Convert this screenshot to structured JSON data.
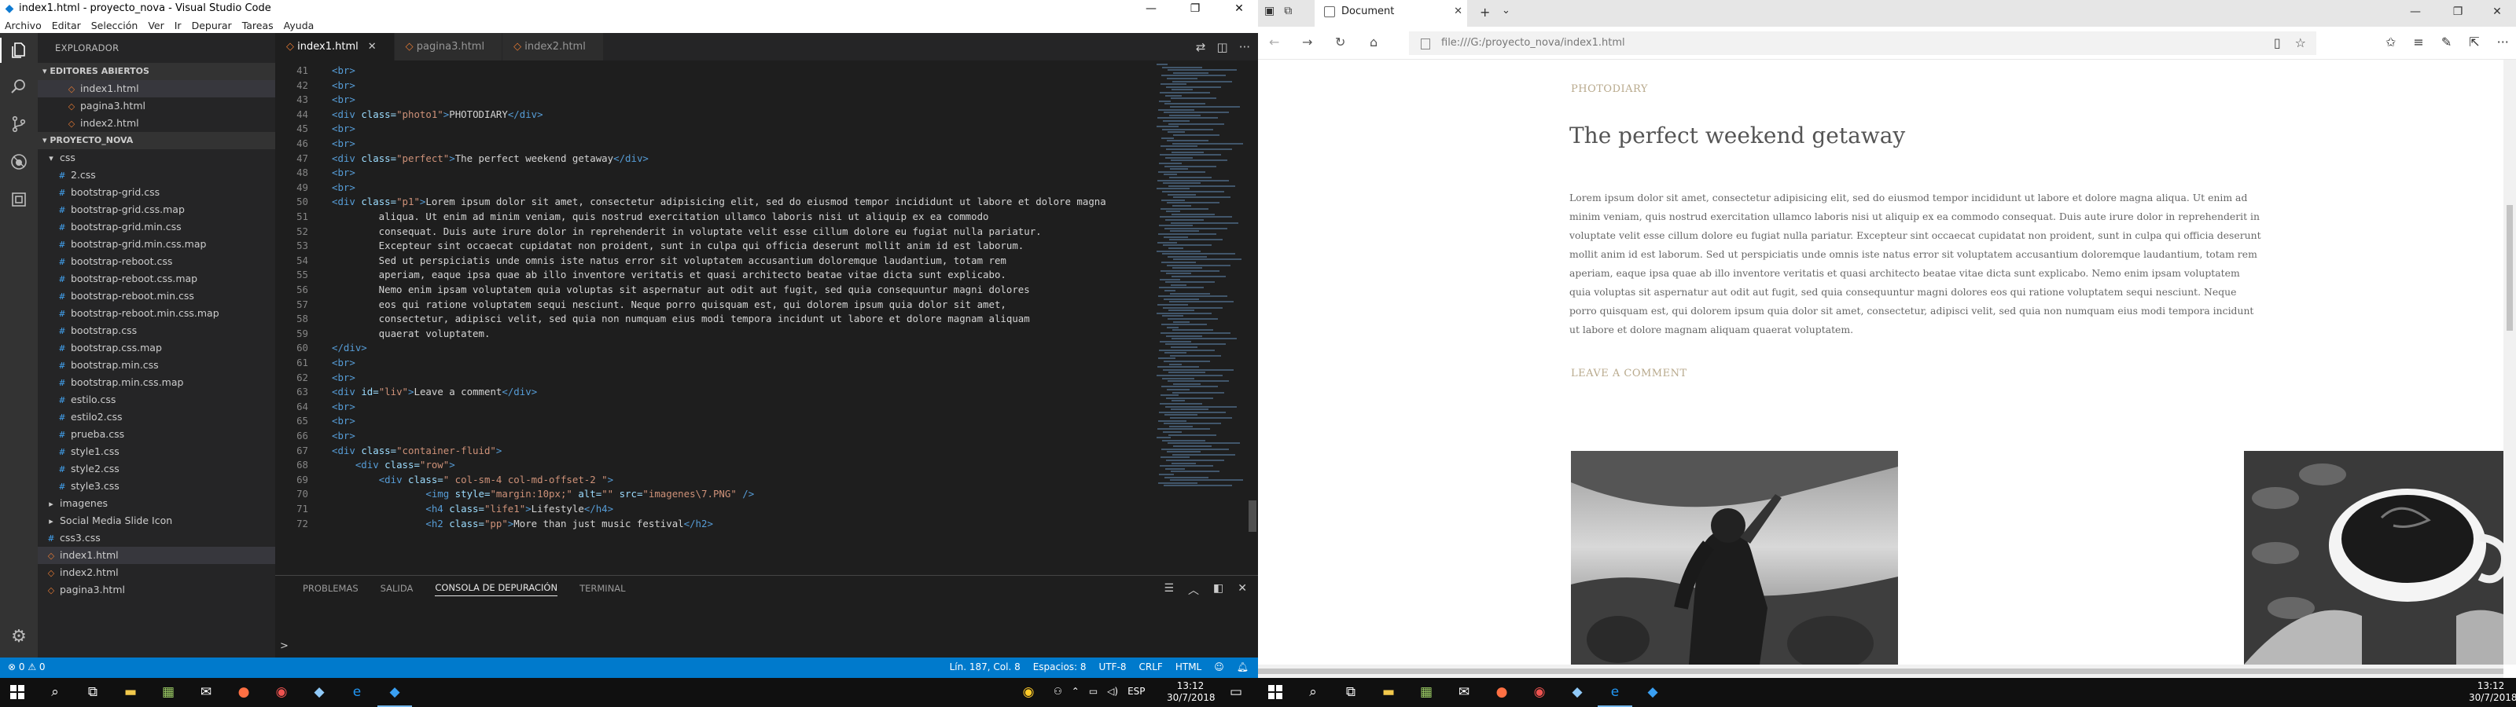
{
  "vscode": {
    "title": "index1.html - proyecto_nova - Visual Studio Code",
    "menu": [
      "Archivo",
      "Editar",
      "Selección",
      "Ver",
      "Ir",
      "Depurar",
      "Tareas",
      "Ayuda"
    ],
    "explorer_title": "EXPLORADOR",
    "open_editors_label": "EDITORES ABIERTOS",
    "open_editors": [
      {
        "name": "index1.html",
        "type": "html",
        "selected": true
      },
      {
        "name": "pagina3.html",
        "type": "html",
        "selected": false
      },
      {
        "name": "index2.html",
        "type": "html",
        "selected": false
      }
    ],
    "project_label": "PROYECTO_NOVA",
    "tree": [
      {
        "name": "css",
        "type": "folder",
        "indent": 1
      },
      {
        "name": "2.css",
        "type": "css",
        "indent": 2
      },
      {
        "name": "bootstrap-grid.css",
        "type": "css",
        "indent": 2
      },
      {
        "name": "bootstrap-grid.css.map",
        "type": "css",
        "indent": 2
      },
      {
        "name": "bootstrap-grid.min.css",
        "type": "css",
        "indent": 2
      },
      {
        "name": "bootstrap-grid.min.css.map",
        "type": "css",
        "indent": 2
      },
      {
        "name": "bootstrap-reboot.css",
        "type": "css",
        "indent": 2
      },
      {
        "name": "bootstrap-reboot.css.map",
        "type": "css",
        "indent": 2
      },
      {
        "name": "bootstrap-reboot.min.css",
        "type": "css",
        "indent": 2
      },
      {
        "name": "bootstrap-reboot.min.css.map",
        "type": "css",
        "indent": 2
      },
      {
        "name": "bootstrap.css",
        "type": "css",
        "indent": 2
      },
      {
        "name": "bootstrap.css.map",
        "type": "css",
        "indent": 2
      },
      {
        "name": "bootstrap.min.css",
        "type": "css",
        "indent": 2
      },
      {
        "name": "bootstrap.min.css.map",
        "type": "css",
        "indent": 2
      },
      {
        "name": "estilo.css",
        "type": "css",
        "indent": 2
      },
      {
        "name": "estilo2.css",
        "type": "css",
        "indent": 2
      },
      {
        "name": "prueba.css",
        "type": "css",
        "indent": 2
      },
      {
        "name": "style1.css",
        "type": "css",
        "indent": 2
      },
      {
        "name": "style2.css",
        "type": "css",
        "indent": 2
      },
      {
        "name": "style3.css",
        "type": "css",
        "indent": 2
      },
      {
        "name": "imagenes",
        "type": "folder-closed",
        "indent": 1
      },
      {
        "name": "Social Media Slide Icon",
        "type": "folder-closed",
        "indent": 1
      },
      {
        "name": "css3.css",
        "type": "css",
        "indent": 1
      },
      {
        "name": "index1.html",
        "type": "html",
        "indent": 1,
        "selected": true
      },
      {
        "name": "index2.html",
        "type": "html",
        "indent": 1
      },
      {
        "name": "pagina3.html",
        "type": "html",
        "indent": 1
      }
    ],
    "tabs": [
      {
        "label": "index1.html",
        "active": true,
        "closable": true
      },
      {
        "label": "pagina3.html",
        "active": false
      },
      {
        "label": "index2.html",
        "active": false
      }
    ],
    "code_lines": [
      {
        "n": "41",
        "parts": [
          [
            "tg",
            "<br>"
          ]
        ]
      },
      {
        "n": "42",
        "parts": [
          [
            "tg",
            "<br>"
          ]
        ]
      },
      {
        "n": "43",
        "parts": [
          [
            "tg",
            "<br>"
          ]
        ]
      },
      {
        "n": "44",
        "parts": [
          [
            "tg",
            "<div "
          ],
          [
            "at",
            "class="
          ],
          [
            "st",
            "\"photo1\""
          ],
          [
            "tg",
            ">"
          ],
          [
            "tx",
            "PHOTODIARY"
          ],
          [
            "tg",
            "</div>"
          ]
        ]
      },
      {
        "n": "45",
        "parts": [
          [
            "tg",
            "<br>"
          ]
        ]
      },
      {
        "n": "46",
        "parts": [
          [
            "tg",
            "<br>"
          ]
        ]
      },
      {
        "n": "47",
        "parts": [
          [
            "tg",
            "<div "
          ],
          [
            "at",
            "class="
          ],
          [
            "st",
            "\"perfect\""
          ],
          [
            "tg",
            ">"
          ],
          [
            "tx",
            "The perfect weekend getaway"
          ],
          [
            "tg",
            "</div>"
          ]
        ]
      },
      {
        "n": "48",
        "parts": [
          [
            "tg",
            "<br>"
          ]
        ]
      },
      {
        "n": "49",
        "parts": [
          [
            "tg",
            "<br>"
          ]
        ]
      },
      {
        "n": "50",
        "parts": [
          [
            "tg",
            "<div "
          ],
          [
            "at",
            "class="
          ],
          [
            "st",
            "\"p1\""
          ],
          [
            "tg",
            ">"
          ],
          [
            "tx",
            "Lorem ipsum dolor sit amet, consectetur adipisicing elit, sed do eiusmod tempor incididunt ut labore et dolore magna"
          ]
        ]
      },
      {
        "n": "51",
        "parts": [
          [
            "tx",
            "        aliqua. Ut enim ad minim veniam, quis nostrud exercitation ullamco laboris nisi ut aliquip ex ea commodo"
          ]
        ]
      },
      {
        "n": "52",
        "parts": [
          [
            "tx",
            "        consequat. Duis aute irure dolor in reprehenderit in voluptate velit esse cillum dolore eu fugiat nulla pariatur."
          ]
        ]
      },
      {
        "n": "53",
        "parts": [
          [
            "tx",
            "        Excepteur sint occaecat cupidatat non proident, sunt in culpa qui officia deserunt mollit anim id est laborum."
          ]
        ]
      },
      {
        "n": "54",
        "parts": [
          [
            "tx",
            "        Sed ut perspiciatis unde omnis iste natus error sit voluptatem accusantium doloremque laudantium, totam rem"
          ]
        ]
      },
      {
        "n": "55",
        "parts": [
          [
            "tx",
            "        aperiam, eaque ipsa quae ab illo inventore veritatis et quasi architecto beatae vitae dicta sunt explicabo."
          ]
        ]
      },
      {
        "n": "56",
        "parts": [
          [
            "tx",
            "        Nemo enim ipsam voluptatem quia voluptas sit aspernatur aut odit aut fugit, sed quia consequuntur magni dolores"
          ]
        ]
      },
      {
        "n": "57",
        "parts": [
          [
            "tx",
            "        eos qui ratione voluptatem sequi nesciunt. Neque porro quisquam est, qui dolorem ipsum quia dolor sit amet,"
          ]
        ]
      },
      {
        "n": "58",
        "parts": [
          [
            "tx",
            "        consectetur, adipisci velit, sed quia non numquam eius modi tempora incidunt ut labore et dolore magnam aliquam"
          ]
        ]
      },
      {
        "n": "59",
        "parts": [
          [
            "tx",
            "        quaerat voluptatem."
          ]
        ]
      },
      {
        "n": "60",
        "parts": [
          [
            "tg",
            "</div>"
          ]
        ]
      },
      {
        "n": "61",
        "parts": [
          [
            "tg",
            "<br>"
          ]
        ]
      },
      {
        "n": "62",
        "parts": [
          [
            "tg",
            "<br>"
          ]
        ]
      },
      {
        "n": "63",
        "parts": [
          [
            "tg",
            "<div "
          ],
          [
            "at",
            "id="
          ],
          [
            "st",
            "\"liv\""
          ],
          [
            "tg",
            ">"
          ],
          [
            "tx",
            "Leave a comment"
          ],
          [
            "tg",
            "</div>"
          ]
        ]
      },
      {
        "n": "64",
        "parts": [
          [
            "tg",
            "<br>"
          ]
        ]
      },
      {
        "n": "65",
        "parts": [
          [
            "tg",
            "<br>"
          ]
        ]
      },
      {
        "n": "66",
        "parts": [
          [
            "tg",
            "<br>"
          ]
        ]
      },
      {
        "n": "67",
        "parts": [
          [
            "tg",
            "<div "
          ],
          [
            "at",
            "class="
          ],
          [
            "st",
            "\"container-fluid\""
          ],
          [
            "tg",
            ">"
          ]
        ]
      },
      {
        "n": "68",
        "parts": [
          [
            "tx",
            "    "
          ],
          [
            "tg",
            "<div "
          ],
          [
            "at",
            "class="
          ],
          [
            "st",
            "\"row\""
          ],
          [
            "tg",
            ">"
          ]
        ]
      },
      {
        "n": "69",
        "parts": [
          [
            "tx",
            "        "
          ],
          [
            "tg",
            "<div "
          ],
          [
            "at",
            "class="
          ],
          [
            "st",
            "\" col-sm-4 col-md-offset-2 \""
          ],
          [
            "tg",
            ">"
          ]
        ]
      },
      {
        "n": "70",
        "parts": [
          [
            "tx",
            "                "
          ],
          [
            "tg",
            "<img "
          ],
          [
            "at",
            "style="
          ],
          [
            "st",
            "\"margin:10px;\""
          ],
          [
            "at",
            " alt="
          ],
          [
            "st",
            "\"\""
          ],
          [
            "at",
            " src="
          ],
          [
            "st",
            "\"imagenes\\7.PNG\""
          ],
          [
            "tg",
            " />"
          ]
        ]
      },
      {
        "n": "71",
        "parts": [
          [
            "tx",
            "                "
          ],
          [
            "tg",
            "<h4 "
          ],
          [
            "at",
            "class="
          ],
          [
            "st",
            "\"life1\""
          ],
          [
            "tg",
            ">"
          ],
          [
            "tx",
            "Lifestyle"
          ],
          [
            "tg",
            "</h4>"
          ]
        ]
      },
      {
        "n": "72",
        "parts": [
          [
            "tx",
            "                "
          ],
          [
            "tg",
            "<h2 "
          ],
          [
            "at",
            "class="
          ],
          [
            "st",
            "\"pp\""
          ],
          [
            "tg",
            ">"
          ],
          [
            "tx",
            "More than just music festival"
          ],
          [
            "tg",
            "</h2>"
          ]
        ]
      }
    ],
    "panel_tabs": [
      {
        "label": "PROBLEMAS",
        "active": false
      },
      {
        "label": "SALIDA",
        "active": false
      },
      {
        "label": "CONSOLA DE DEPURACIÓN",
        "active": true
      },
      {
        "label": "TERMINAL",
        "active": false
      }
    ],
    "prompt": ">",
    "status_left": "⊗ 0  ⚠ 0",
    "status_right": [
      "Lín. 187, Col. 8",
      "Espacios: 8",
      "UTF-8",
      "CRLF",
      "HTML"
    ],
    "badge": "1"
  },
  "browser": {
    "tab_title": "Document",
    "url": "file:///G:/proyecto_nova/index1.html",
    "page": {
      "photo1": "PHOTODIARY",
      "perfect": "The perfect weekend getaway",
      "p1": "Lorem ipsum dolor sit amet, consectetur adipisicing elit, sed do eiusmod tempor incididunt ut labore et dolore magna aliqua. Ut enim ad minim veniam, quis nostrud exercitation ullamco laboris nisi ut aliquip ex ea commodo consequat. Duis aute irure dolor in reprehenderit in voluptate velit esse cillum dolore eu fugiat nulla pariatur. Excepteur sint occaecat cupidatat non proident, sunt in culpa qui officia deserunt mollit anim id est laborum. Sed ut perspiciatis unde omnis iste natus error sit voluptatem accusantium doloremque laudantium, totam rem aperiam, eaque ipsa quae ab illo inventore veritatis et quasi architecto beatae vitae dicta sunt explicabo. Nemo enim ipsam voluptatem quia voluptas sit aspernatur aut odit aut fugit, sed quia consequuntur magni dolores eos qui ratione voluptatem sequi nesciunt. Neque porro quisquam est, qui dolorem ipsum quia dolor sit amet, consectetur, adipisci velit, sed quia non numquam eius modi tempora incidunt ut labore et dolore magnam aliquam quaerat voluptatem.",
      "liv": "LEAVE A COMMENT"
    }
  },
  "taskbar_left": {
    "lang": "ESP",
    "time": "13:12",
    "date": "30/7/2018"
  },
  "taskbar_right": {
    "time": "13:12",
    "date": "30/7/2018"
  },
  "colors": {
    "vscode_blue": "#007acc",
    "accent_label": "#b8a98c"
  }
}
